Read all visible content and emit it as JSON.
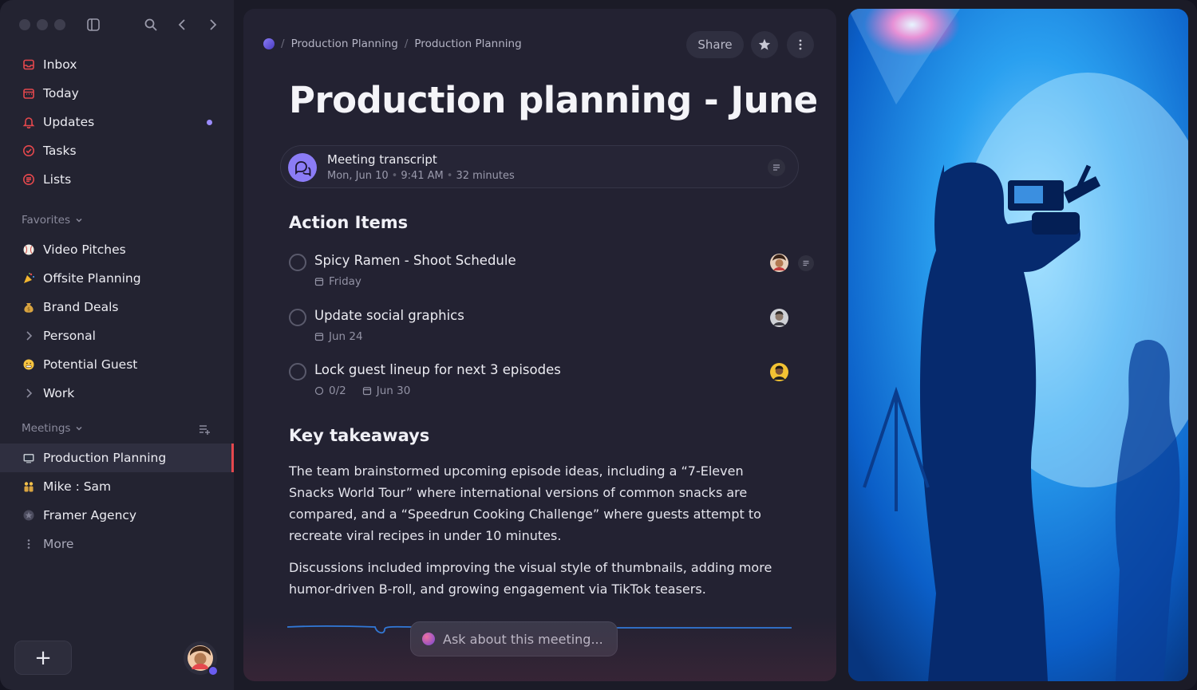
{
  "sidebar": {
    "nav": [
      {
        "label": "Inbox",
        "icon": "inbox-icon"
      },
      {
        "label": "Today",
        "icon": "calendar-icon"
      },
      {
        "label": "Updates",
        "icon": "bell-icon"
      },
      {
        "label": "Tasks",
        "icon": "check-circle-icon"
      },
      {
        "label": "Lists",
        "icon": "list-icon"
      }
    ],
    "favorites_label": "Favorites",
    "favorites": [
      {
        "label": "Video Pitches",
        "icon": "baseball-icon"
      },
      {
        "label": "Offsite Planning",
        "icon": "party-popper-icon"
      },
      {
        "label": "Brand Deals",
        "icon": "money-bag-icon"
      },
      {
        "label": "Personal",
        "icon": "chevron-right-icon"
      },
      {
        "label": "Potential Guest",
        "icon": "grimace-emoji-icon"
      },
      {
        "label": "Work",
        "icon": "chevron-right-icon"
      }
    ],
    "meetings_label": "Meetings",
    "meetings": [
      {
        "label": "Production Planning",
        "icon": "tv-icon"
      },
      {
        "label": "Mike : Sam",
        "icon": "people-icon"
      },
      {
        "label": "Framer Agency",
        "icon": "star-badge-icon"
      },
      {
        "label": "More",
        "icon": "more-vertical-icon"
      }
    ],
    "add_label": "+"
  },
  "header": {
    "breadcrumb": [
      "Production Planning",
      "Production Planning"
    ],
    "share_label": "Share"
  },
  "page": {
    "title": "Production planning - June",
    "transcript": {
      "title": "Meeting transcript",
      "date": "Mon, Jun 10",
      "time": "9:41 AM",
      "duration": "32 minutes"
    },
    "action_items_heading": "Action Items",
    "tasks": [
      {
        "title": "Spicy Ramen - Shoot Schedule",
        "due": "Friday",
        "subtasks": ""
      },
      {
        "title": "Update social graphics",
        "due": "Jun 24",
        "subtasks": ""
      },
      {
        "title": "Lock guest lineup for next 3 episodes",
        "due": "Jun 30",
        "subtasks": "0/2"
      }
    ],
    "takeaways_heading": "Key takeaways",
    "takeaways": [
      "The team brainstormed upcoming episode ideas, including a “7-Eleven Snacks World Tour” where international versions of common snacks are compared, and a “Speedrun Cooking Challenge” where guests attempt to recreate viral recipes in under 10 minutes.",
      "Discussions included improving the visual style of thumbnails, adding more humor-driven B-roll, and growing engagement via TikTok teasers."
    ],
    "ask_placeholder": "Ask about this meeting..."
  },
  "colors": {
    "accent_red": "#e5484d",
    "accent_purple": "#8b7cf6",
    "sidebar_bg": "#232331",
    "main_bg": "#232232"
  }
}
